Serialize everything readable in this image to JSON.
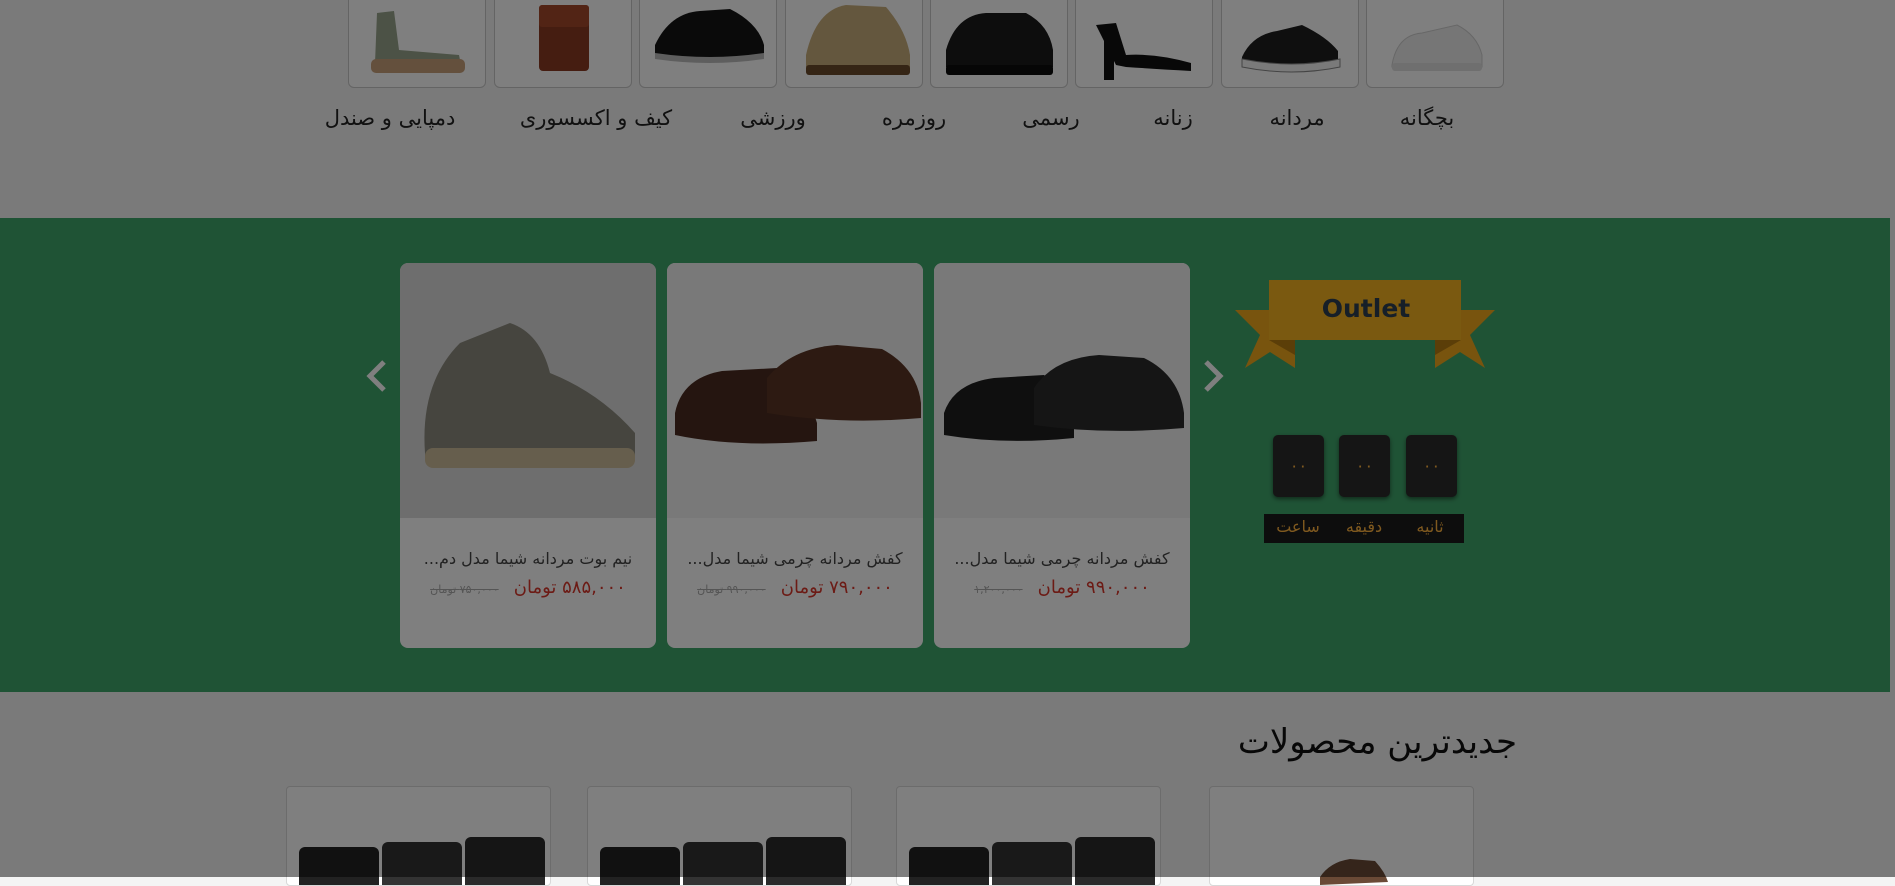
{
  "categories": [
    {
      "label": "بچگانه",
      "icon": "white-sneaker-icon"
    },
    {
      "label": "مردانه",
      "icon": "black-sneaker-icon"
    },
    {
      "label": "زنانه",
      "icon": "black-heel-icon"
    },
    {
      "label": "رسمی",
      "icon": "black-derby-shoe-icon"
    },
    {
      "label": "روزمره",
      "icon": "tan-boot-icon"
    },
    {
      "label": "ورزشی",
      "icon": "black-sport-shoe-icon"
    },
    {
      "label": "کیف و اکسسوری",
      "icon": "brown-bag-icon"
    },
    {
      "label": "دمپایی و صندل",
      "icon": "sandal-icon"
    }
  ],
  "outlet": {
    "badge": "Outlet",
    "timer": {
      "seconds": "۰۰",
      "minutes": "۰۰",
      "hours": "۰۰",
      "seconds_label": "ثانیه",
      "minutes_label": "دقیقه",
      "hours_label": "ساعت"
    },
    "products": [
      {
        "name": "کفش مردانه چرمی شیما مدل...",
        "price": "۹۹۰,۰۰۰ تومان",
        "old_price": "۱,۲۰۰,۰۰۰"
      },
      {
        "name": "کفش مردانه چرمی شیما مدل...",
        "price": "۷۹۰,۰۰۰ تومان",
        "old_price": "۹۹۰,۰۰۰ تومان"
      },
      {
        "name": "نیم بوت مردانه شیما مدل دم...",
        "price": "۵۸۵,۰۰۰ تومان",
        "old_price": "۷۵۰,۰۰۰ تومان"
      }
    ]
  },
  "newest": {
    "title": "جدیدترین محصولات"
  },
  "colors": {
    "green_section": "#3fa66b",
    "ribbon": "#f0a81c",
    "price_red": "#d9362b",
    "timer_text": "#ffb23e"
  }
}
